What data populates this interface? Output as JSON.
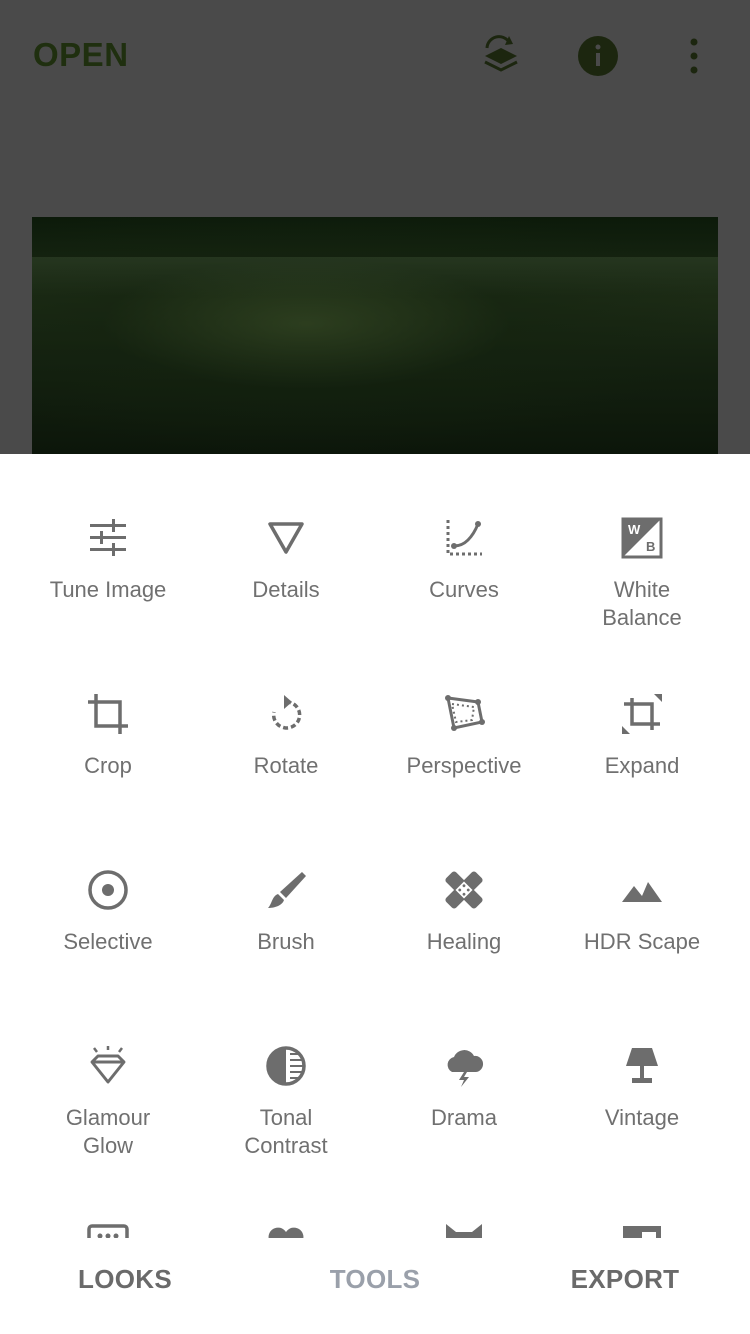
{
  "header": {
    "open_label": "OPEN",
    "icons": [
      "undo-stack-icon",
      "info-icon",
      "more-vert-icon"
    ]
  },
  "tools": [
    {
      "label": "Tune Image",
      "icon": "tune-icon"
    },
    {
      "label": "Details",
      "icon": "triangle-icon"
    },
    {
      "label": "Curves",
      "icon": "curves-icon"
    },
    {
      "label": "White\nBalance",
      "icon": "white-balance-icon"
    },
    {
      "label": "Crop",
      "icon": "crop-icon"
    },
    {
      "label": "Rotate",
      "icon": "rotate-icon"
    },
    {
      "label": "Perspective",
      "icon": "perspective-icon"
    },
    {
      "label": "Expand",
      "icon": "expand-icon"
    },
    {
      "label": "Selective",
      "icon": "selective-icon"
    },
    {
      "label": "Brush",
      "icon": "brush-icon"
    },
    {
      "label": "Healing",
      "icon": "healing-icon"
    },
    {
      "label": "HDR Scape",
      "icon": "mountains-icon"
    },
    {
      "label": "Glamour\nGlow",
      "icon": "diamond-icon"
    },
    {
      "label": "Tonal\nContrast",
      "icon": "tonal-contrast-icon"
    },
    {
      "label": "Drama",
      "icon": "storm-cloud-icon"
    },
    {
      "label": "Vintage",
      "icon": "lamp-icon"
    }
  ],
  "bottom_nav": {
    "looks": "LOOKS",
    "tools": "TOOLS",
    "export": "EXPORT"
  },
  "colors": {
    "overlay": "#4a4a4a",
    "icon_gray": "#6d6d6d",
    "active_tab": "#9aa0aa"
  }
}
